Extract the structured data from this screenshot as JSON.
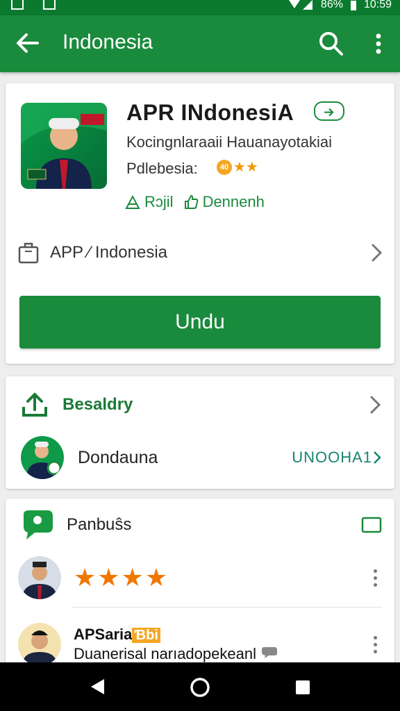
{
  "status_bar": {
    "battery": "86%",
    "time": "10:59"
  },
  "app_bar": {
    "title": "Indonesia"
  },
  "app": {
    "name": "APR INdonesiA",
    "developer": "Kocingnlaraaii Hauanayotakiai",
    "category": "Pdlebesia:",
    "rating_badge": "40",
    "rating_stars": "★★",
    "tags": [
      "Rɔjil",
      "Dennenh"
    ],
    "icon_label": "APP",
    "briefcase_label": "APP ⁄ Indonesia",
    "install_label": "Undu"
  },
  "developer_section": {
    "title": "Besaldry",
    "name": "Dondauna",
    "link": "UNOOHA1"
  },
  "reviews_section": {
    "title": "Panbuŝs",
    "reviews": [
      {
        "stars": "★★★★"
      },
      {
        "name": "APSaria",
        "badge": "Ɓbi",
        "text": "Duanerisal narıadopekeanl"
      }
    ]
  },
  "colors": {
    "primary": "#1a8a3c",
    "status_bar": "#0b7a2e",
    "star": "#f07800"
  }
}
